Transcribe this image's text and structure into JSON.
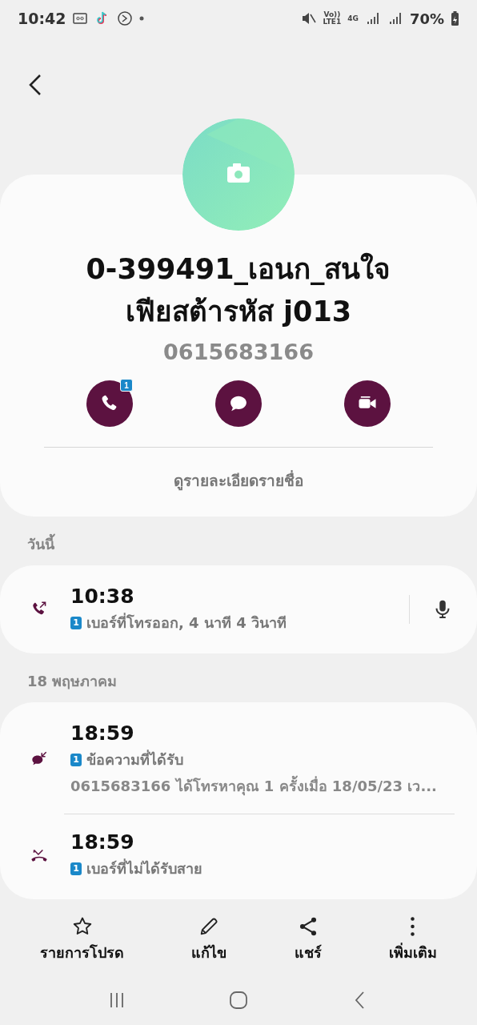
{
  "status_bar": {
    "time": "10:42",
    "volte": "Vo))",
    "lte": "LTE1",
    "network": "4G",
    "battery": "70%"
  },
  "contact": {
    "name_lines": [
      "0-399491_เอนก_สนใจ",
      "เฟียสต้ารหัส j013"
    ],
    "phone": "0615683166",
    "actions": [
      {
        "kind": "call",
        "badge": "1"
      },
      {
        "kind": "message"
      },
      {
        "kind": "video"
      }
    ],
    "details_link": "ดูรายละเอียดรายชื่อ"
  },
  "log": [
    {
      "header": "วันนี้",
      "entries": [
        {
          "kind": "outgoing",
          "time": "10:38",
          "sim": "1",
          "detail": "เบอร์ที่โทรออก, 4 นาที 4 วินาที",
          "recording": true
        }
      ]
    },
    {
      "header": "18 พฤษภาคม",
      "entries": [
        {
          "kind": "message",
          "time": "18:59",
          "sim": "1",
          "detail": "ข้อความที่ได้รับ",
          "extra": "0615683166 ได้โทรหาคุณ 1 ครั้งเมื่อ 18/05/23 เว...",
          "recording": false
        },
        {
          "kind": "missed",
          "time": "18:59",
          "sim": "1",
          "detail": "เบอร์ที่ไม่ได้รับสาย",
          "recording": false
        }
      ]
    }
  ],
  "bottom_actions": [
    {
      "kind": "favorite",
      "label": "รายการโปรด"
    },
    {
      "kind": "edit",
      "label": "แก้ไข"
    },
    {
      "kind": "share",
      "label": "แชร์"
    },
    {
      "kind": "more",
      "label": "เพิ่มเติม"
    }
  ]
}
